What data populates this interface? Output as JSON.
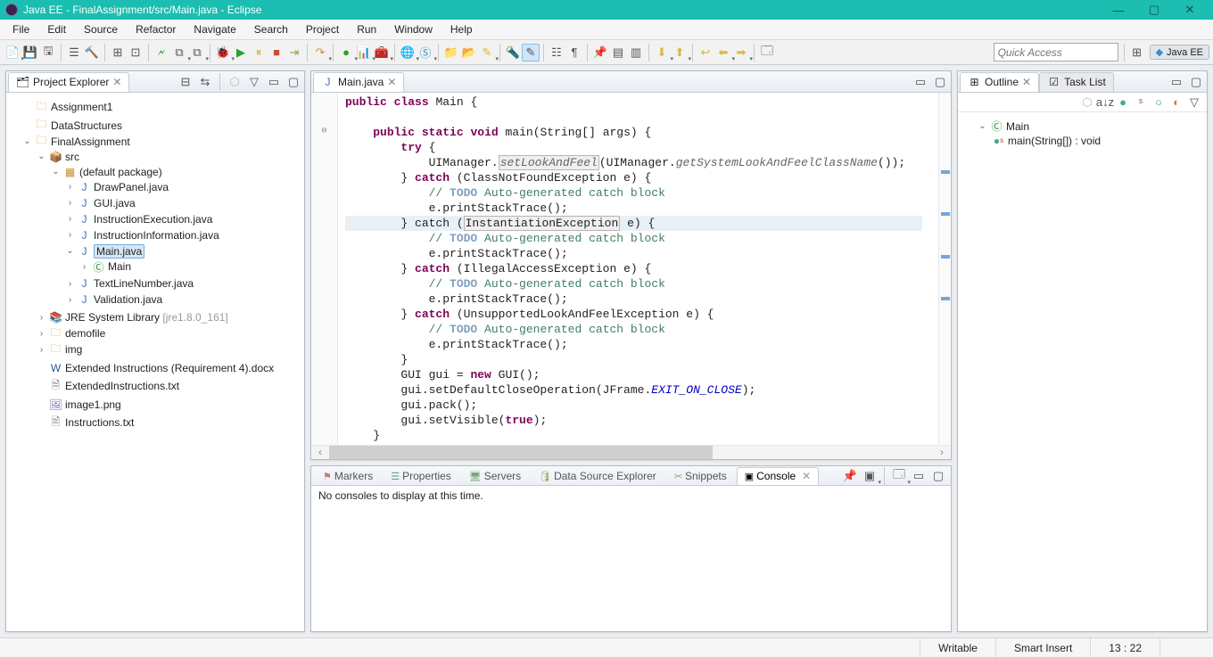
{
  "title": "Java EE - FinalAssignment/src/Main.java - Eclipse",
  "menubar": [
    "File",
    "Edit",
    "Source",
    "Refactor",
    "Navigate",
    "Search",
    "Project",
    "Run",
    "Window",
    "Help"
  ],
  "quick_access_placeholder": "Quick Access",
  "perspective_label": "Java EE",
  "project_explorer": {
    "title": "Project Explorer",
    "items": {
      "assignment1": "Assignment1",
      "datastructures": "DataStructures",
      "finalassignment": "FinalAssignment",
      "src": "src",
      "default_package": "(default package)",
      "drawpanel": "DrawPanel.java",
      "gui": "GUI.java",
      "instructionexecution": "InstructionExecution.java",
      "instructioninformation": "InstructionInformation.java",
      "main": "Main.java",
      "main_class": "Main",
      "textlinenumber": "TextLineNumber.java",
      "validation": "Validation.java",
      "jre": "JRE System Library",
      "jre_ver": "[jre1.8.0_161]",
      "demofile": "demofile",
      "img": "img",
      "ext_docx": "Extended Instructions (Requirement 4).docx",
      "ext_txt": "ExtendedInstructions.txt",
      "image1": "image1.png",
      "instructions_txt": "Instructions.txt"
    }
  },
  "editor": {
    "tab_label": "Main.java",
    "lines": {
      "l1": "public class Main {",
      "l2": "",
      "l3_a": "    public static void main(String[] args) {",
      "l4": "        try {",
      "l5_a": "            UIManager.",
      "l5_b": "setLookAndFeel",
      "l5_c": "(UIManager.",
      "l5_d": "getSystemLookAndFeelClassName",
      "l5_e": "());",
      "l6": "        } catch (ClassNotFoundException e) {",
      "l7": "            // TODO Auto-generated catch block",
      "l8": "            e.printStackTrace();",
      "l9_a": "        } catch (",
      "l9_b": "InstantiationException",
      "l9_c": " e) {",
      "l10": "            // TODO Auto-generated catch block",
      "l11": "            e.printStackTrace();",
      "l12": "        } catch (IllegalAccessException e) {",
      "l13": "            // TODO Auto-generated catch block",
      "l14": "            e.printStackTrace();",
      "l15": "        } catch (UnsupportedLookAndFeelException e) {",
      "l16": "            // TODO Auto-generated catch block",
      "l17": "            e.printStackTrace();",
      "l18": "        }",
      "l19_a": "        GUI gui = ",
      "l19_b": "new",
      "l19_c": " GUI();",
      "l20_a": "        gui.setDefaultCloseOperation(JFrame.",
      "l20_b": "EXIT_ON_CLOSE",
      "l20_c": ");",
      "l21": "        gui.pack();",
      "l22_a": "        gui.setVisible(",
      "l22_b": "true",
      "l22_c": ");",
      "l23": "    }"
    }
  },
  "outline": {
    "title": "Outline",
    "tasklist": "Task List",
    "root": "Main",
    "method": "main(String[]) : void"
  },
  "bottom": {
    "tabs": {
      "markers": "Markers",
      "properties": "Properties",
      "servers": "Servers",
      "dse": "Data Source Explorer",
      "snippets": "Snippets",
      "console": "Console"
    },
    "console_msg": "No consoles to display at this time."
  },
  "statusbar": {
    "writable": "Writable",
    "insert": "Smart Insert",
    "pos": "13 : 22"
  }
}
